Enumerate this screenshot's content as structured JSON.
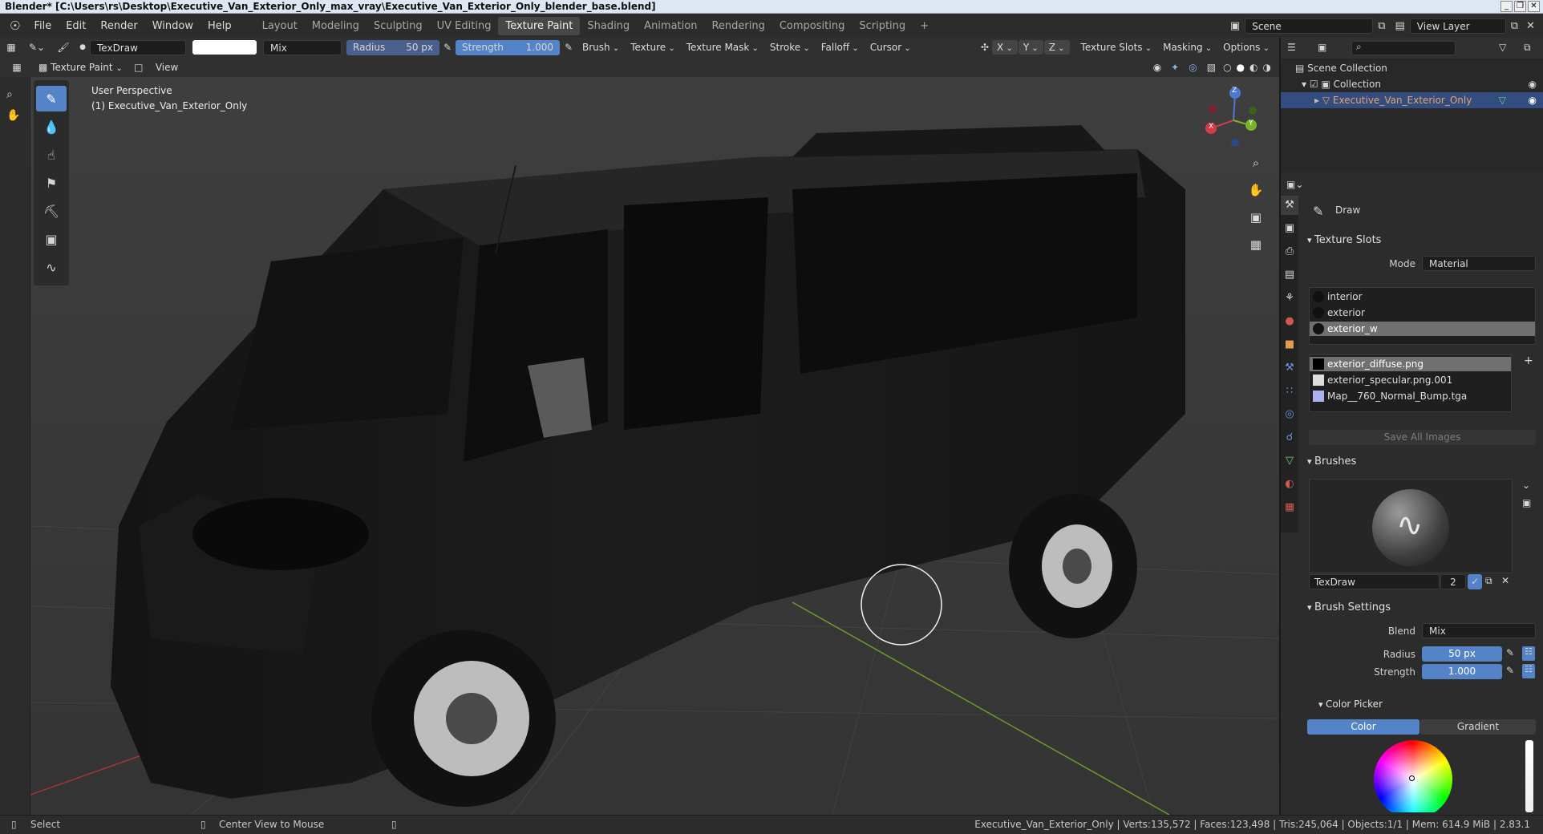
{
  "window": {
    "title": "Blender* [C:\\Users\\rs\\Desktop\\Executive_Van_Exterior_Only_max_vray\\Executive_Van_Exterior_Only_blender_base.blend]"
  },
  "menu": [
    "File",
    "Edit",
    "Render",
    "Window",
    "Help"
  ],
  "workspaces": [
    "Layout",
    "Modeling",
    "Sculpting",
    "UV Editing",
    "Texture Paint",
    "Shading",
    "Animation",
    "Rendering",
    "Compositing",
    "Scripting"
  ],
  "active_workspace": "Texture Paint",
  "scene": {
    "name": "Scene",
    "view_layer": "View Layer"
  },
  "tool_header": {
    "brush_name": "TexDraw",
    "blend": "Mix",
    "radius_label": "Radius",
    "radius_value": "50 px",
    "strength_label": "Strength",
    "strength_value": "1.000",
    "strength_fraction": 1.0,
    "menus": [
      "Brush",
      "Texture",
      "Texture Mask",
      "Stroke",
      "Falloff",
      "Cursor"
    ],
    "symmetry": [
      "X",
      "Y",
      "Z"
    ],
    "right_menus": [
      "Texture Slots",
      "Masking",
      "Options"
    ]
  },
  "editor_header": {
    "mode": "Texture Paint",
    "view": "View"
  },
  "viewport": {
    "perspective": "User Perspective",
    "object": "(1) Executive_Van_Exterior_Only",
    "gizmo_labels": [
      "Z",
      "X",
      "Y"
    ]
  },
  "outliner": {
    "root": "Scene Collection",
    "collection": "Collection",
    "object": "Executive_Van_Exterior_Only"
  },
  "properties": {
    "tool_name": "Draw",
    "texture_slots": {
      "title": "Texture Slots",
      "mode_label": "Mode",
      "mode": "Material",
      "materials": [
        "interior",
        "exterior",
        "exterior_w"
      ],
      "selected_material": "exterior_w",
      "images": [
        "exterior_diffuse.png",
        "exterior_specular.png.001",
        "Map__760_Normal_Bump.tga"
      ],
      "selected_image": "exterior_diffuse.png",
      "save_button": "Save All Images"
    },
    "brushes": {
      "title": "Brushes",
      "brush": "TexDraw",
      "users": "2"
    },
    "brush_settings": {
      "title": "Brush Settings",
      "blend_label": "Blend",
      "blend": "Mix",
      "radius_label": "Radius",
      "radius": "50 px",
      "strength_label": "Strength",
      "strength": "1.000"
    },
    "color_picker": {
      "title": "Color Picker",
      "tabs": [
        "Color",
        "Gradient"
      ],
      "active": "Color"
    }
  },
  "status": {
    "select": "Select",
    "center": "Center View to Mouse",
    "stats": "Executive_Van_Exterior_Only | Verts:135,572 | Faces:123,498 | Tris:245,064 | Objects:1/1 | Mem: 614.9 MiB | 2.83.1"
  },
  "colors": {
    "accent": "#5583c8",
    "selection": "#334d80",
    "background": "#3d3d3d"
  }
}
